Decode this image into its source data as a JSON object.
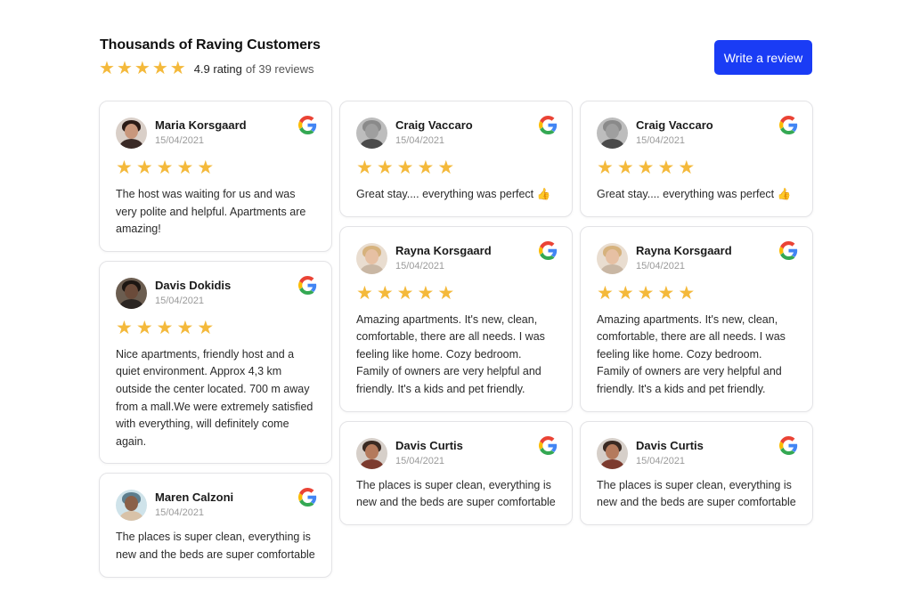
{
  "header": {
    "title": "Thousands of Raving Customers",
    "rating_value": "4.9 rating",
    "rating_suffix": "of 39 reviews",
    "stars": 5,
    "write_button_label": "Write a review"
  },
  "colors": {
    "accent": "#1a3cf5",
    "star": "#f4b93b"
  },
  "columns": [
    [
      {
        "name": "Maria Korsgaard",
        "date": "15/04/2021",
        "stars": 5,
        "text": "The host was waiting for us and was very polite and helpful. Apartments are amazing!",
        "avatar": "woman-dark-hair"
      },
      {
        "name": "Davis Dokidis",
        "date": "15/04/2021",
        "stars": 5,
        "text": "Nice apartments, friendly host and a quiet environment. Approx 4,3 km outside the center located. 700 m away from a mall.We were extremely satisfied with everything, will definitely come again.",
        "avatar": "man-dark"
      },
      {
        "name": "Maren Calzoni",
        "date": "15/04/2021",
        "stars": 0,
        "text": "The places is super clean, everything is new and the beds are super comfortable",
        "avatar": "woman-headwrap"
      }
    ],
    [
      {
        "name": "Craig Vaccaro",
        "date": "15/04/2021",
        "stars": 5,
        "text": "Great stay.... everything was perfect 👍",
        "avatar": "man-bald-beard"
      },
      {
        "name": "Rayna Korsgaard",
        "date": "15/04/2021",
        "stars": 5,
        "text": "Amazing apartments. It's new, clean, comfortable, there are all needs. I was feeling like home. Cozy bedroom. Family of owners are very helpful and friendly. It's a kids and pet friendly.",
        "avatar": "woman-blonde"
      },
      {
        "name": "Davis Curtis",
        "date": "15/04/2021",
        "stars": 0,
        "text": "The places is super clean, everything is new and the beds are super comfortable",
        "avatar": "man-beard"
      }
    ],
    [
      {
        "name": "Craig Vaccaro",
        "date": "15/04/2021",
        "stars": 5,
        "text": "Great stay.... everything was perfect 👍",
        "avatar": "man-bald-beard"
      },
      {
        "name": "Rayna Korsgaard",
        "date": "15/04/2021",
        "stars": 5,
        "text": "Amazing apartments. It's new, clean, comfortable, there are all needs. I was feeling like home. Cozy bedroom. Family of owners are very helpful and friendly. It's a kids and pet friendly.",
        "avatar": "woman-blonde"
      },
      {
        "name": "Davis Curtis",
        "date": "15/04/2021",
        "stars": 0,
        "text": "The places is super clean, everything is new and the beds are super comfortable",
        "avatar": "man-beard"
      }
    ]
  ],
  "review_source_icon": "google-icon"
}
